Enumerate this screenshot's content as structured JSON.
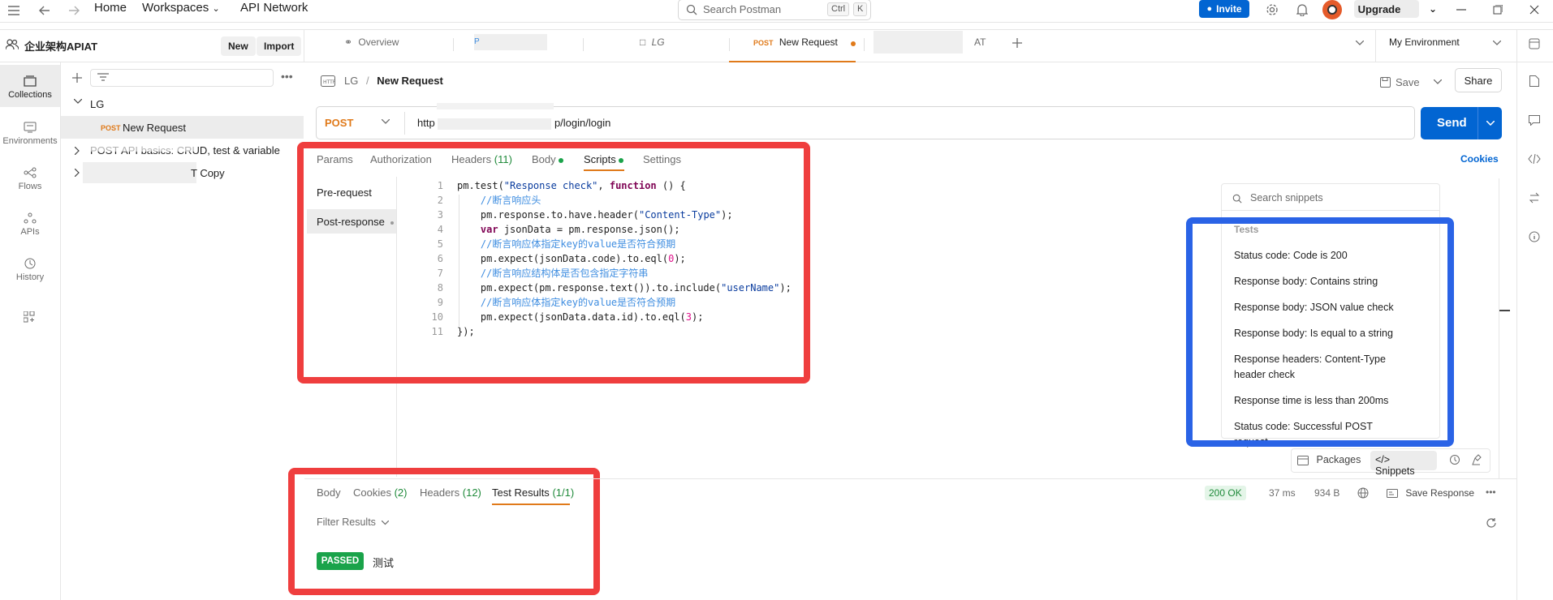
{
  "topbar": {
    "home": "Home",
    "workspaces": "Workspaces",
    "api_network": "API Network",
    "search_placeholder": "Search Postman",
    "kbd_ctrl": "Ctrl",
    "kbd_k": "K",
    "invite": "Invite",
    "upgrade": "Upgrade"
  },
  "workspace": {
    "name": "企业架构APIAT",
    "new": "New",
    "import": "Import"
  },
  "rail": [
    {
      "label": "Collections",
      "icon": "collections-icon"
    },
    {
      "label": "Environments",
      "icon": "environments-icon"
    },
    {
      "label": "Flows",
      "icon": "flows-icon"
    },
    {
      "label": "APIs",
      "icon": "apis-icon"
    },
    {
      "label": "History",
      "icon": "history-icon"
    }
  ],
  "sidebar": {
    "tree": [
      {
        "label": "LG"
      },
      {
        "method": "POST",
        "label": "New Request"
      },
      {
        "label": "POST API basics: CRUD, test & variable"
      },
      {
        "label": "T Copy"
      }
    ]
  },
  "tabs": {
    "overview": "Overview",
    "lg": "LG",
    "new_request_method": "POST",
    "new_request": "New Request",
    "tab5_suffix": "AT",
    "environment": "My Environment"
  },
  "request": {
    "breadcrumb_parent": "LG",
    "breadcrumb_sep": "/",
    "breadcrumb_current": "New Request",
    "save": "Save",
    "share": "Share",
    "method": "POST",
    "url_prefix": "http",
    "url_suffix": "p/login/login",
    "send": "Send",
    "cookies": "Cookies",
    "tabs": [
      "Params",
      "Authorization",
      "Headers",
      "(11)",
      "Body",
      "Scripts",
      "Settings"
    ],
    "script_types": [
      "Pre-request",
      "Post-response"
    ]
  },
  "code": {
    "lines": [
      "pm.test(\"Response check\", function () {",
      "    //断言响应头",
      "    pm.response.to.have.header(\"Content-Type\");",
      "    var jsonData = pm.response.json();",
      "    //断言响应体指定key的value是否符合预期",
      "    pm.expect(jsonData.code).to.eql(0);",
      "    //断言响应结构体是否包含指定字符串",
      "    pm.expect(pm.response.text()).to.include(\"userName\");",
      "    //断言响应体指定key的value是否符合预期",
      "    pm.expect(jsonData.data.id).to.eql(3);",
      "});"
    ],
    "line_numbers": [
      "1",
      "2",
      "3",
      "4",
      "5",
      "6",
      "7",
      "8",
      "9",
      "10",
      "11"
    ]
  },
  "snippets": {
    "search_placeholder": "Search snippets",
    "section": "Tests",
    "items": [
      "Status code: Code is 200",
      "Response body: Contains string",
      "Response body: JSON value check",
      "Response body: Is equal to a string",
      "Response headers: Content-Type header check",
      "Response time is less than 200ms",
      "Status code: Successful POST request"
    ],
    "packages": "Packages",
    "snippets_btn": "Snippets"
  },
  "response": {
    "tabs": [
      "Body",
      "Cookies",
      "(2)",
      "Headers",
      "(12)",
      "Test Results",
      "(1/1)"
    ],
    "status": "200 OK",
    "time": "37 ms",
    "size": "934 B",
    "save_response": "Save Response",
    "filter": "Filter Results",
    "passed": "PASSED",
    "test_name": "测试"
  },
  "colors": {
    "accent": "#0265d2",
    "orange": "#e07a1a",
    "red_box": "#ef3e3e",
    "blue_box": "#2a63e6",
    "passed": "#1aa34a"
  }
}
